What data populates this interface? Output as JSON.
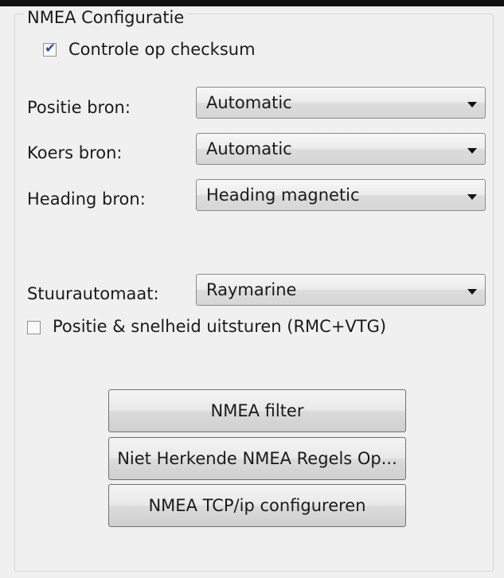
{
  "group": {
    "title": "NMEA Configuratie"
  },
  "checksum": {
    "label": "Controle op checksum",
    "checked": true
  },
  "position_source": {
    "label": "Positie bron:",
    "value": "Automatic"
  },
  "course_source": {
    "label": "Koers bron:",
    "value": "Automatic"
  },
  "heading_source": {
    "label": "Heading bron:",
    "value": "Heading magnetic"
  },
  "autopilot": {
    "label": "Stuurautomaat:",
    "value": "Raymarine"
  },
  "send_position": {
    "label": "Positie & snelheid uitsturen (RMC+VTG)",
    "checked": false
  },
  "buttons": {
    "filter": "NMEA filter",
    "unrecognized": "Niet Herkende NMEA Regels Op...",
    "tcp": "NMEA TCP/ip configureren"
  },
  "icons": {
    "check": "checkmark-icon",
    "dropdown": "chevron-down-icon"
  }
}
